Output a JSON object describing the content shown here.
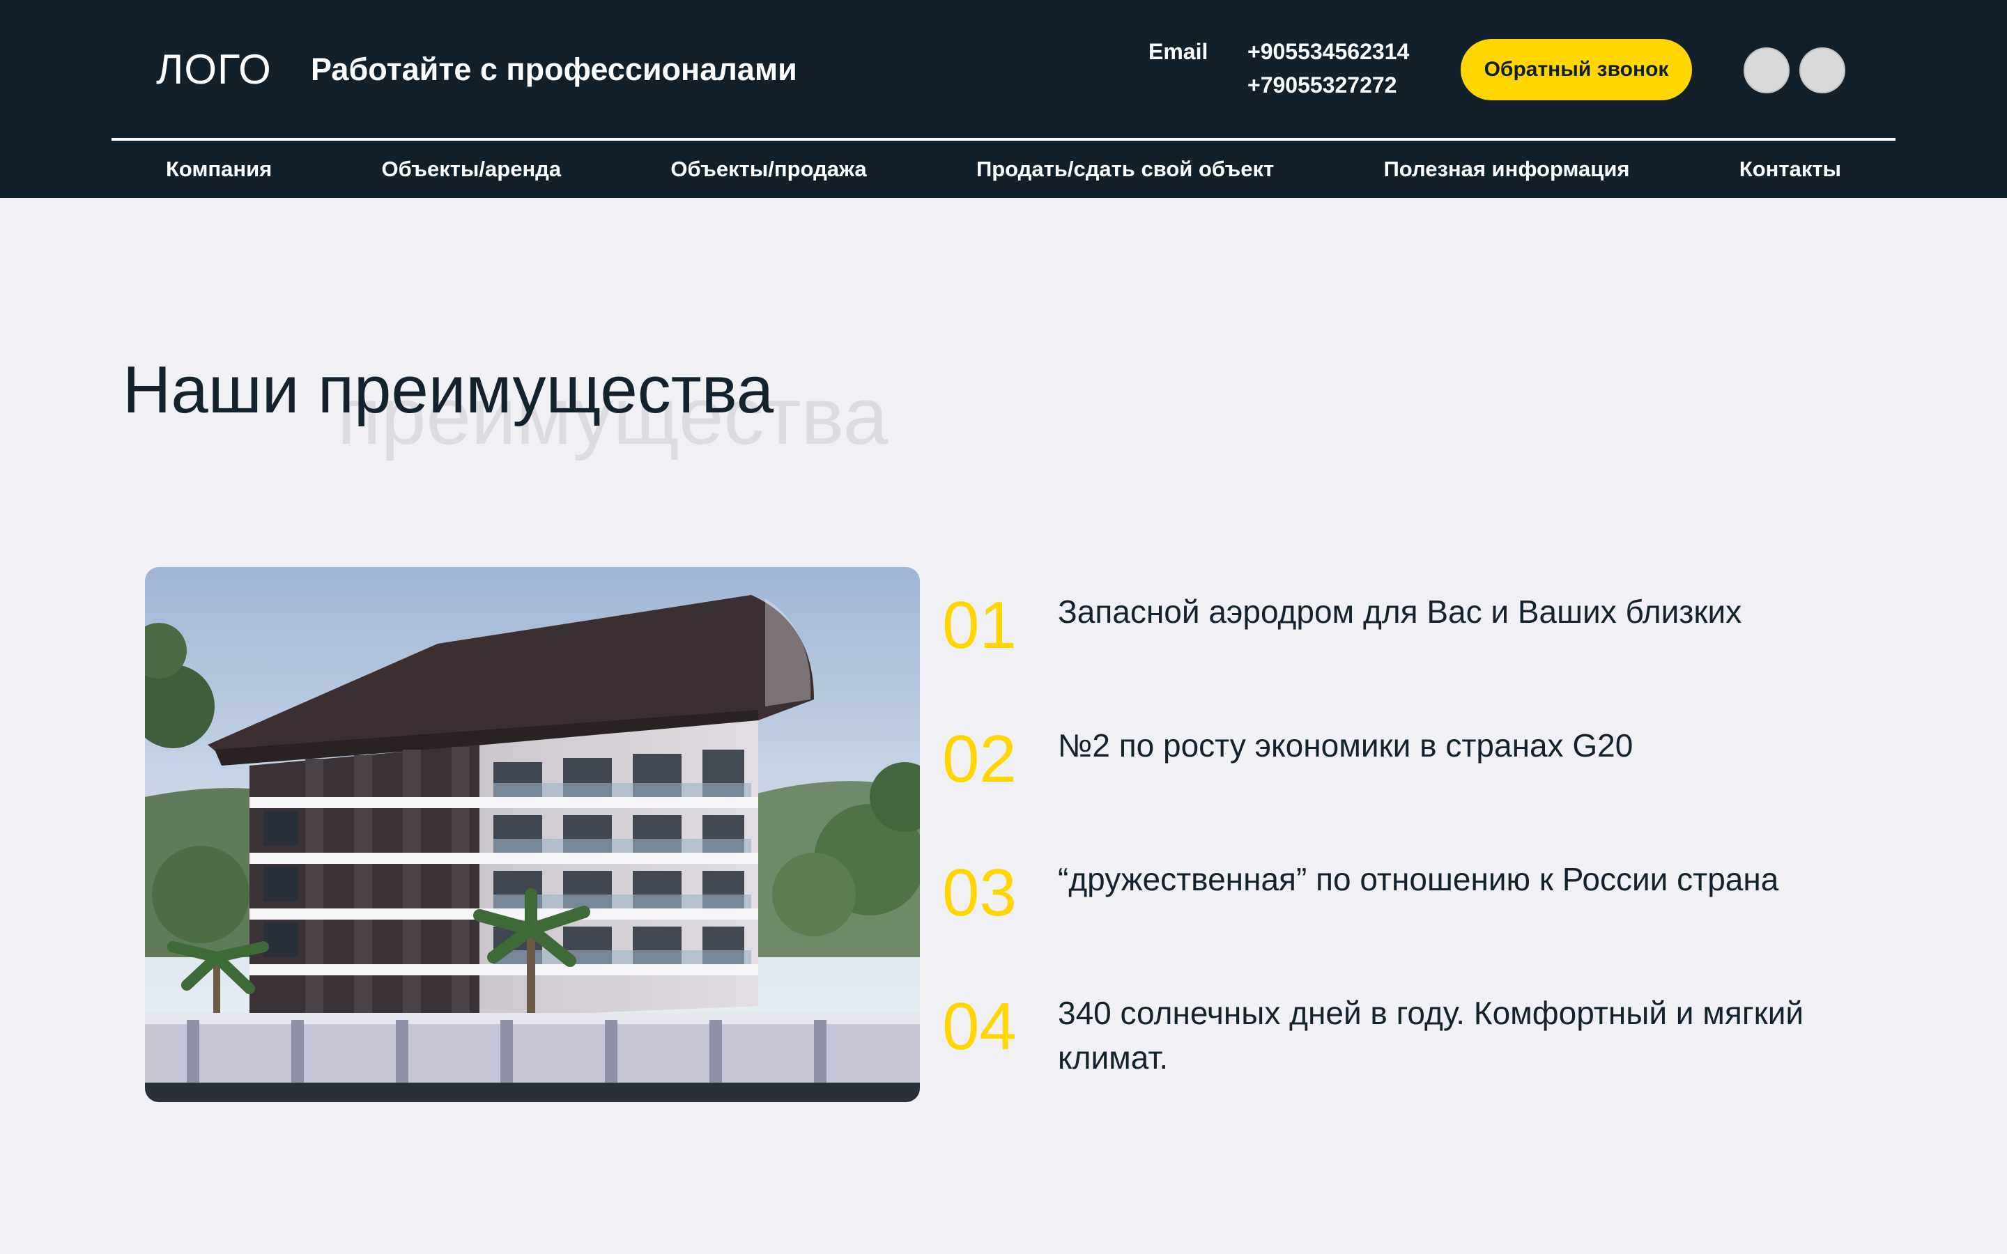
{
  "header": {
    "logo": "ЛОГО",
    "tagline": "Работайте с профессионалами",
    "email_label": "Email",
    "phones": [
      "+905534562314",
      "+79055327272"
    ],
    "callback_label": "Обратный звонок",
    "social_icons": [
      "social-icon-1",
      "social-icon-2"
    ]
  },
  "nav": {
    "items": [
      "Компания",
      "Объекты/аренда",
      "Объекты/продажа",
      "Продать/сдать свой объект",
      "Полезная информация",
      "Контакты"
    ]
  },
  "section": {
    "title": "Наши преимущества",
    "ghost_title": "преимущества",
    "image": "building-photo",
    "advantages": [
      {
        "num": "01",
        "text": "Запасной аэродром для Вас и Ваших близких"
      },
      {
        "num": "02",
        "text": "№2 по росту экономики в странах G20"
      },
      {
        "num": "03",
        "text": "“дружественная” по отношению к России страна"
      },
      {
        "num": "04",
        "text": "340 солнечных дней в году. Комфортный и мягкий климат."
      }
    ]
  },
  "colors": {
    "header_bg": "#11202b",
    "page_bg": "#f1f0f4",
    "accent": "#ffd600",
    "text_dark": "#14222d"
  }
}
